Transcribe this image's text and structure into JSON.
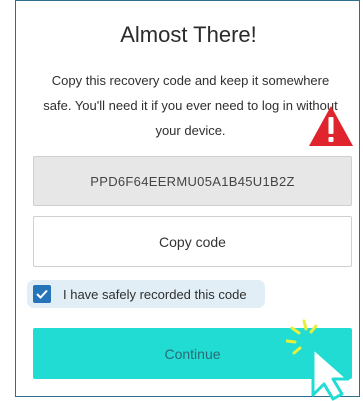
{
  "dialog": {
    "title": "Almost There!",
    "description": "Copy this recovery code and keep it somewhere safe. You'll need it if you ever need to log in without your device.",
    "recovery_code": "PPD6F64EERMU05A1B45U1B2Z",
    "copy_button_label": "Copy code",
    "checkbox_label": "I have safely recorded this code",
    "checkbox_checked": true,
    "continue_button_label": "Continue"
  },
  "colors": {
    "border": "#2f6f8d",
    "code_bg": "#e7e7e7",
    "checkbox_bg": "#2573b8",
    "checkbox_row_bg": "#e1eef6",
    "continue_bg": "#20dcd3",
    "continue_text": "#2a6b75",
    "warning_red": "#e0242e",
    "highlight_yellow": "#e6ef3a"
  },
  "icons": {
    "warning": "warning-triangle-icon",
    "checkmark": "checkmark-icon",
    "cursor": "mouse-pointer-icon",
    "click": "click-burst-icon"
  }
}
